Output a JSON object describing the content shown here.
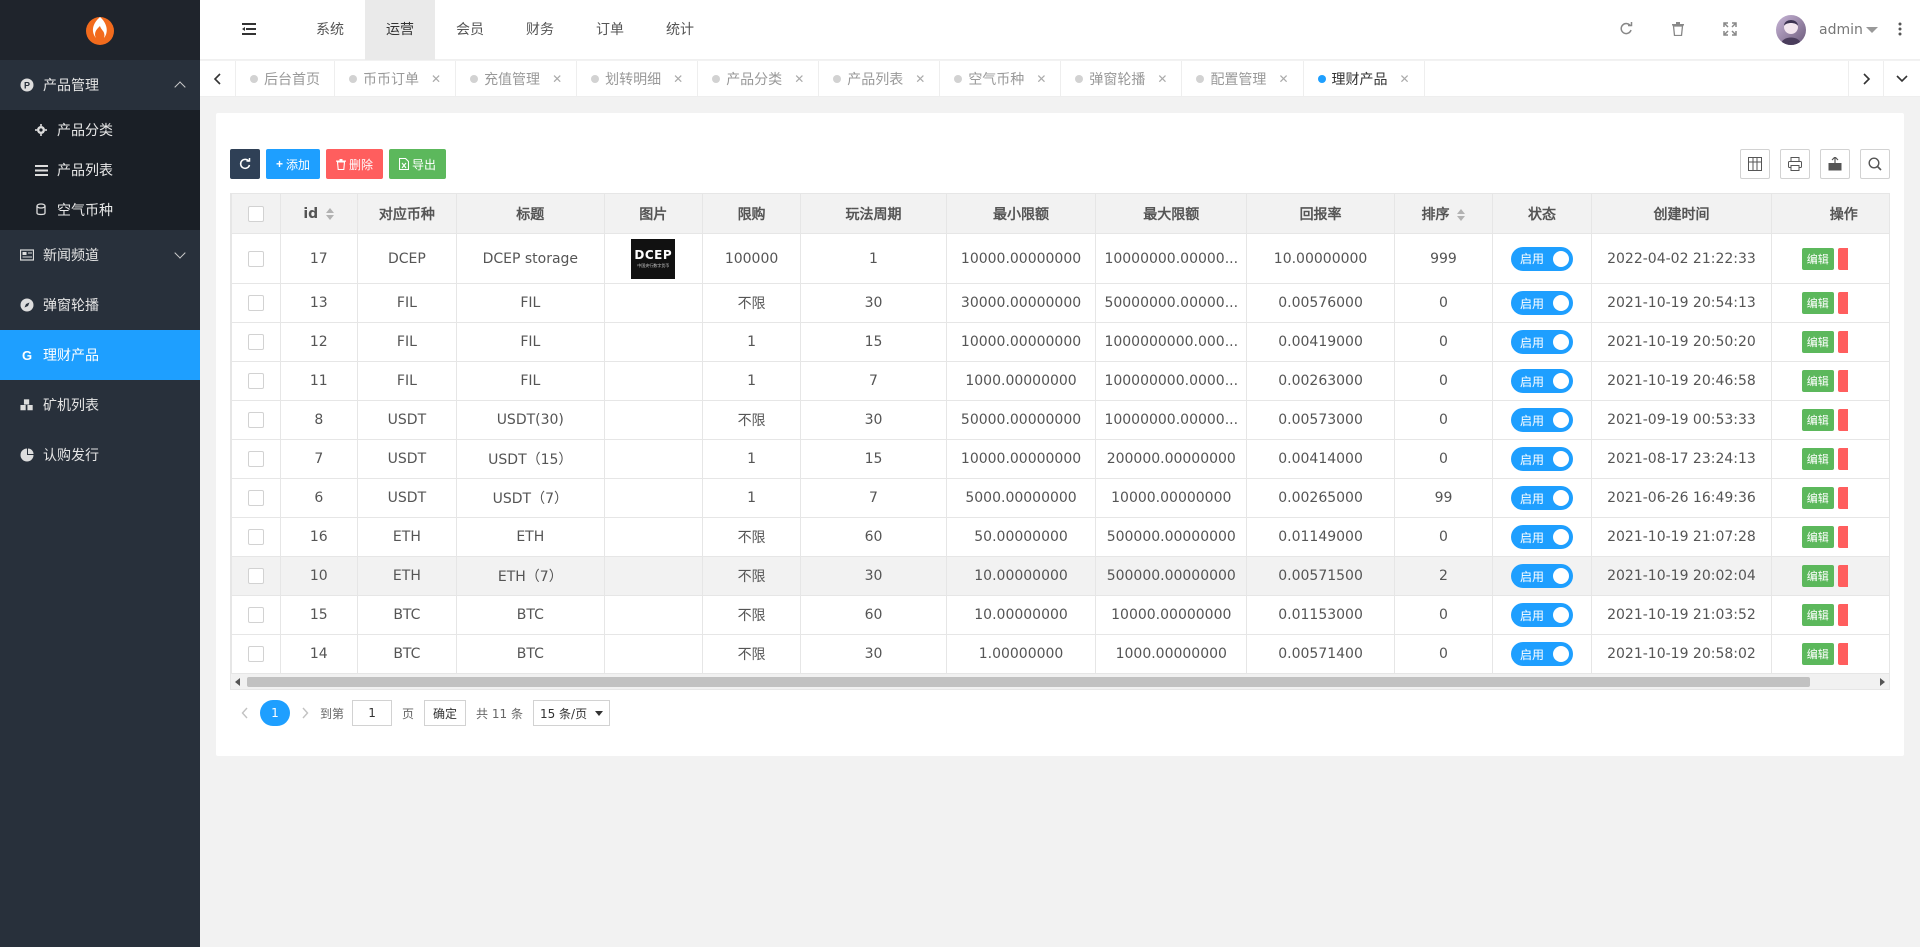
{
  "sidebar": {
    "groups": [
      {
        "label": "产品管理",
        "icon": "product-circle-icon",
        "expanded": true,
        "children": [
          {
            "label": "产品分类",
            "icon": "gear-icon"
          },
          {
            "label": "产品列表",
            "icon": "list-icon"
          },
          {
            "label": "空气币种",
            "icon": "coin-icon"
          }
        ]
      }
    ],
    "items": [
      {
        "label": "新闻频道",
        "icon": "newspaper-icon"
      },
      {
        "label": "弹窗轮播",
        "icon": "compass-icon"
      },
      {
        "label": "理财产品",
        "icon": "g-icon",
        "active": true
      },
      {
        "label": "矿机列表",
        "icon": "cubes-icon"
      },
      {
        "label": "认购发行",
        "icon": "pie-icon"
      }
    ]
  },
  "header": {
    "tabs": [
      "系统",
      "运营",
      "会员",
      "财务",
      "订单",
      "统计"
    ],
    "active_tab": "运营",
    "user": "admin"
  },
  "tabbar": {
    "tabs": [
      "后台首页",
      "币币订单",
      "充值管理",
      "划转明细",
      "产品分类",
      "产品列表",
      "空气币种",
      "弹窗轮播",
      "配置管理",
      "理财产品"
    ],
    "active": "理财产品"
  },
  "toolbar": {
    "add": "添加",
    "delete": "删除",
    "export": "导出"
  },
  "table": {
    "columns": [
      "id",
      "对应币种",
      "标题",
      "图片",
      "限购",
      "玩法周期",
      "最小限额",
      "最大限额",
      "回报率",
      "排序",
      "状态",
      "创建时间",
      "操作"
    ],
    "image_text": "DCEP",
    "image_subtext": "中国央行数字货币",
    "status_label": "启用",
    "edit_label": "编辑",
    "rows": [
      {
        "id": "17",
        "coin": "DCEP",
        "title": "DCEP storage",
        "has_image": true,
        "limit": "100000",
        "cycle": "1",
        "min": "10000.00000000",
        "max": "10000000.00000...",
        "rate": "10.00000000",
        "sort": "999",
        "created": "2022-04-02 21:22:33"
      },
      {
        "id": "13",
        "coin": "FIL",
        "title": "FIL",
        "has_image": false,
        "limit": "不限",
        "cycle": "30",
        "min": "30000.00000000",
        "max": "50000000.00000...",
        "rate": "0.00576000",
        "sort": "0",
        "created": "2021-10-19 20:54:13"
      },
      {
        "id": "12",
        "coin": "FIL",
        "title": "FIL",
        "has_image": false,
        "limit": "1",
        "cycle": "15",
        "min": "10000.00000000",
        "max": "1000000000.000...",
        "rate": "0.00419000",
        "sort": "0",
        "created": "2021-10-19 20:50:20"
      },
      {
        "id": "11",
        "coin": "FIL",
        "title": "FIL",
        "has_image": false,
        "limit": "1",
        "cycle": "7",
        "min": "1000.00000000",
        "max": "100000000.0000...",
        "rate": "0.00263000",
        "sort": "0",
        "created": "2021-10-19 20:46:58"
      },
      {
        "id": "8",
        "coin": "USDT",
        "title": "USDT(30)",
        "has_image": false,
        "limit": "不限",
        "cycle": "30",
        "min": "50000.00000000",
        "max": "10000000.00000...",
        "rate": "0.00573000",
        "sort": "0",
        "created": "2021-09-19 00:53:33"
      },
      {
        "id": "7",
        "coin": "USDT",
        "title": "USDT（15）",
        "has_image": false,
        "limit": "1",
        "cycle": "15",
        "min": "10000.00000000",
        "max": "200000.00000000",
        "rate": "0.00414000",
        "sort": "0",
        "created": "2021-08-17 23:24:13"
      },
      {
        "id": "6",
        "coin": "USDT",
        "title": "USDT（7）",
        "has_image": false,
        "limit": "1",
        "cycle": "7",
        "min": "5000.00000000",
        "max": "10000.00000000",
        "rate": "0.00265000",
        "sort": "99",
        "created": "2021-06-26 16:49:36"
      },
      {
        "id": "16",
        "coin": "ETH",
        "title": "ETH",
        "has_image": false,
        "limit": "不限",
        "cycle": "60",
        "min": "50.00000000",
        "max": "500000.00000000",
        "rate": "0.01149000",
        "sort": "0",
        "created": "2021-10-19 21:07:28"
      },
      {
        "id": "10",
        "coin": "ETH",
        "title": "ETH（7）",
        "has_image": false,
        "limit": "不限",
        "cycle": "30",
        "min": "10.00000000",
        "max": "500000.00000000",
        "rate": "0.00571500",
        "sort": "2",
        "created": "2021-10-19 20:02:04",
        "highlight": true
      },
      {
        "id": "15",
        "coin": "BTC",
        "title": "BTC",
        "has_image": false,
        "limit": "不限",
        "cycle": "60",
        "min": "10.00000000",
        "max": "10000.00000000",
        "rate": "0.01153000",
        "sort": "0",
        "created": "2021-10-19 21:03:52"
      },
      {
        "id": "14",
        "coin": "BTC",
        "title": "BTC",
        "has_image": false,
        "limit": "不限",
        "cycle": "30",
        "min": "1.00000000",
        "max": "1000.00000000",
        "rate": "0.00571400",
        "sort": "0",
        "created": "2021-10-19 20:58:02"
      }
    ]
  },
  "pager": {
    "current": "1",
    "goto_label": "到第",
    "goto_value": "1",
    "page_label": "页",
    "confirm": "确定",
    "total": "共 11 条",
    "page_size": "15 条/页"
  },
  "colors": {
    "sidebar_bg": "#28303b",
    "accent": "#1e9fff",
    "add": "#1e9fff",
    "delete": "#ff5e5e",
    "export": "#5cb85c"
  }
}
